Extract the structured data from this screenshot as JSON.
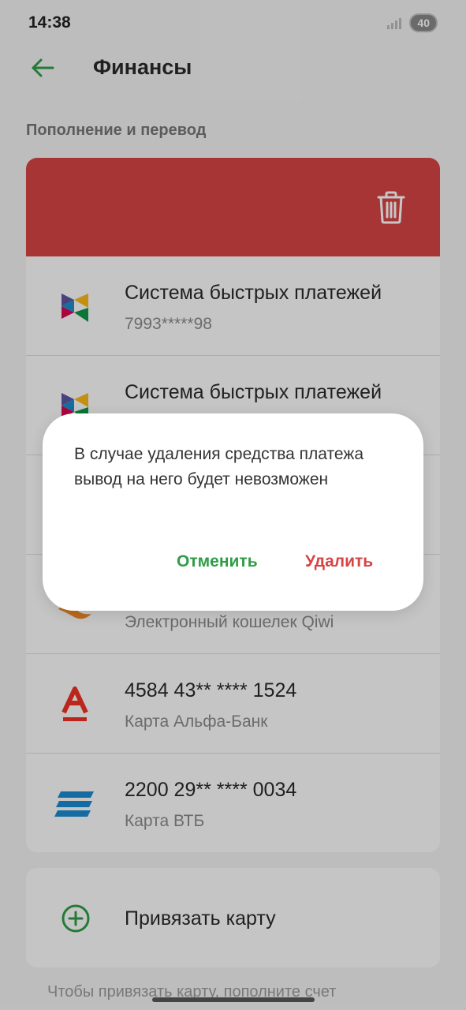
{
  "status": {
    "time": "14:38",
    "battery": "40"
  },
  "app": {
    "title": "Финансы"
  },
  "section": {
    "title": "Пополнение и перевод"
  },
  "methods": [
    {
      "title": "Система быстрых платежей",
      "subtitle": "7993*****98",
      "icon": "sbp-icon"
    },
    {
      "title": "Система быстрых платежей",
      "subtitle": "",
      "icon": "sbp-icon"
    },
    {
      "title": "",
      "subtitle": "",
      "icon": ""
    },
    {
      "title": "",
      "subtitle": "Электронный кошелек Qiwi",
      "icon": "qiwi-icon"
    },
    {
      "title": "4584 43** **** 1524",
      "subtitle": "Карта Альфа-Банк",
      "icon": "alfa-bank-icon"
    },
    {
      "title": "2200 29** **** 0034",
      "subtitle": "Карта ВТБ",
      "icon": "vtb-icon"
    }
  ],
  "add_card": {
    "label": "Привязать карту"
  },
  "hint": "Чтобы привязать карту, пополните счет",
  "dialog": {
    "message": "В случае удаления средства платежа вывод на него будет невозможен",
    "cancel": "Отменить",
    "delete": "Удалить"
  },
  "colors": {
    "accent": "#2e9e46",
    "danger": "#d64545"
  }
}
